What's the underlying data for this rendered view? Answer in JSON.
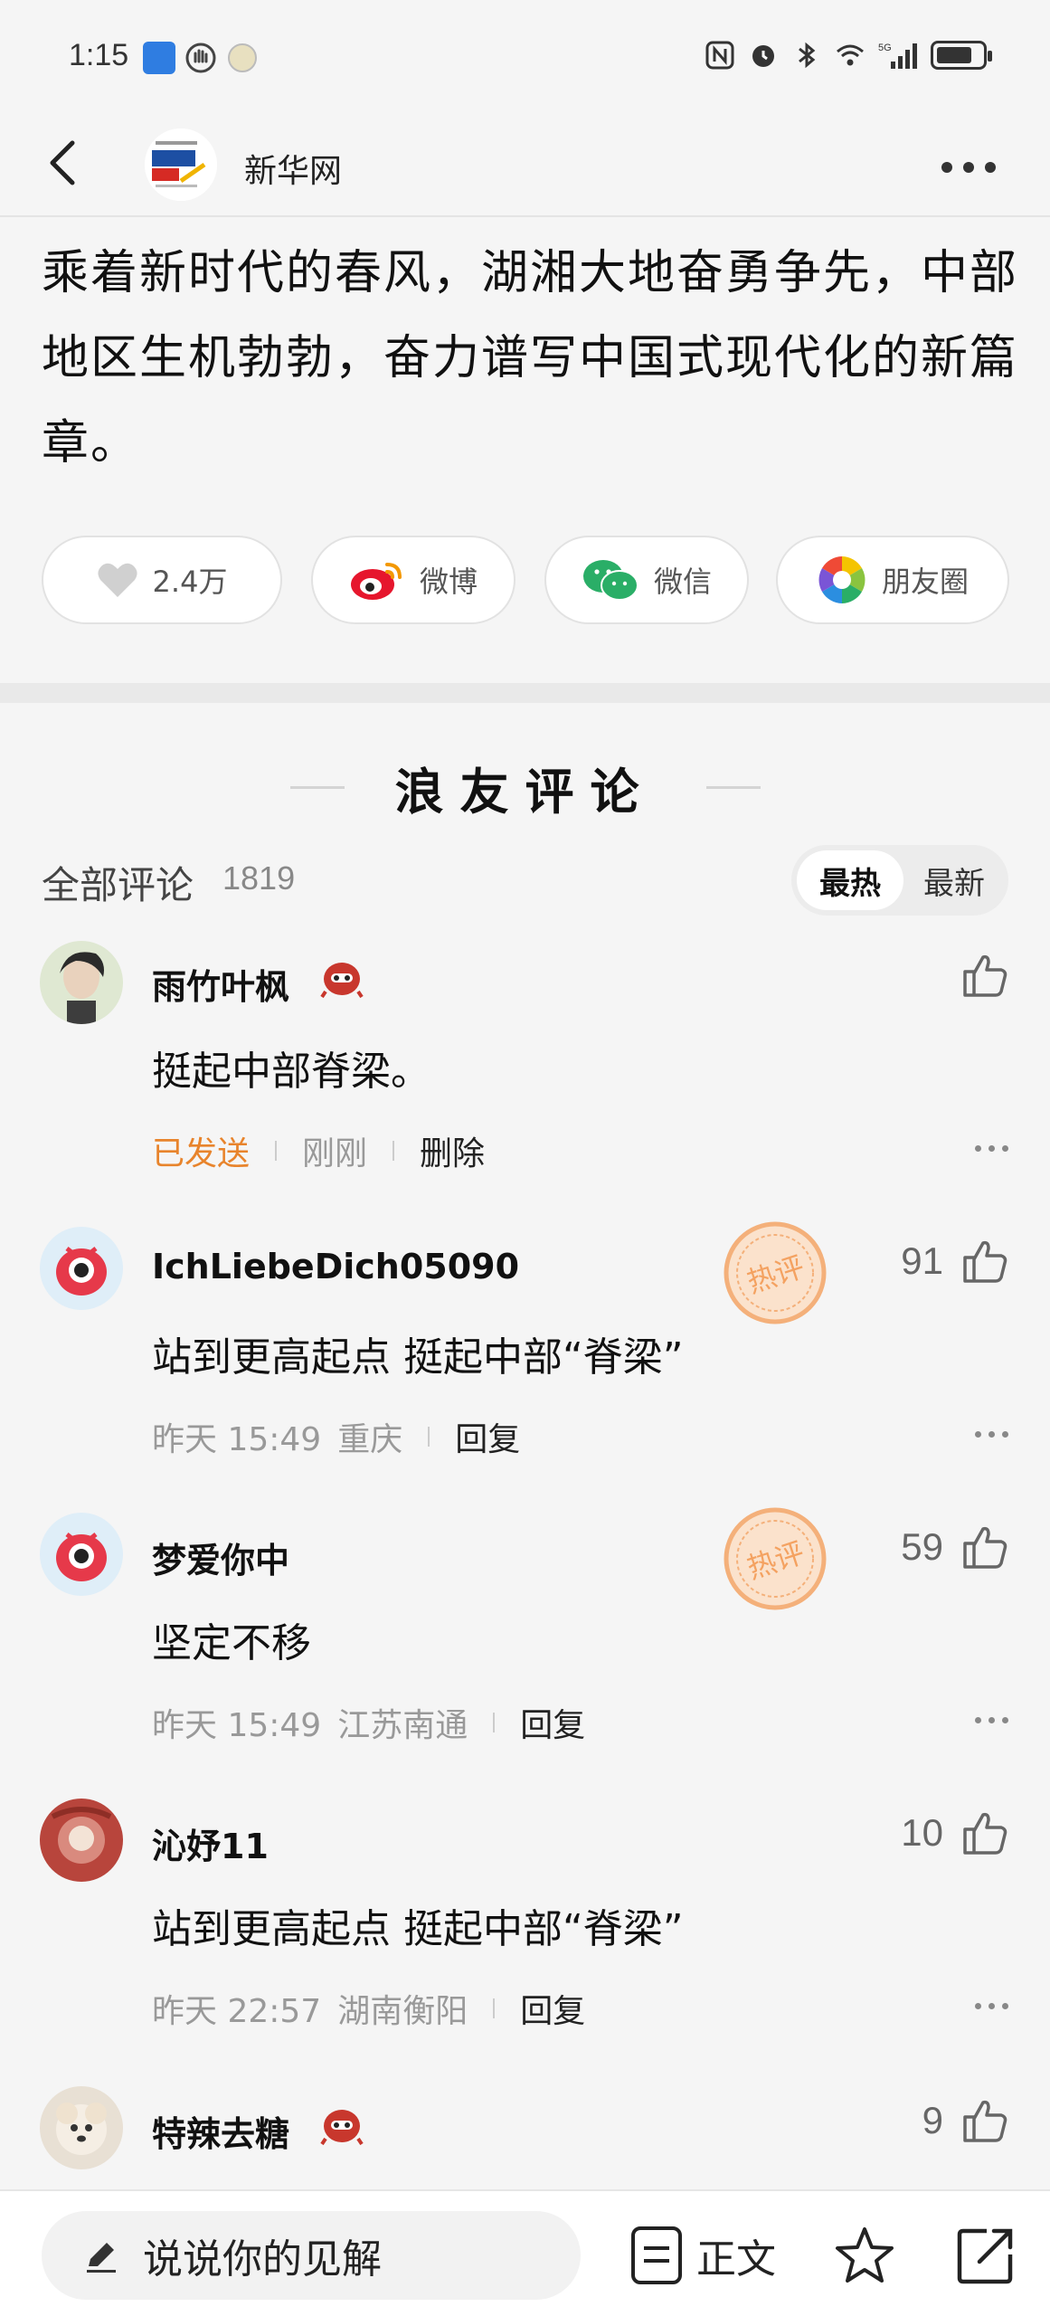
{
  "status_bar": {
    "time": "1:15",
    "network": "5G"
  },
  "header": {
    "site_name": "新华网"
  },
  "article": {
    "text": "乘着新时代的春风，湖湘大地奋勇争先，中部地区生机勃勃，奋力谱写中国式现代化的新篇章。"
  },
  "share": {
    "likes": "2.4万",
    "weibo": "微博",
    "wechat": "微信",
    "moments": "朋友圈"
  },
  "comments_section": {
    "title": "浪友评论",
    "all_label": "全部评论",
    "count": "1819",
    "sort_hot": "最热",
    "sort_new": "最新"
  },
  "comments": [
    {
      "name": "雨竹叶枫",
      "text": "挺起中部脊梁。",
      "status": "已发送",
      "time": "刚刚",
      "action": "删除",
      "likes": ""
    },
    {
      "name": "IchLiebeDich05090",
      "text": "站到更高起点 挺起中部“脊梁”",
      "time": "昨天 15:49",
      "location": "重庆",
      "action": "回复",
      "likes": "91",
      "hot_label": "热评"
    },
    {
      "name": "梦爱你中",
      "text": "坚定不移",
      "time": "昨天 15:49",
      "location": "江苏南通",
      "action": "回复",
      "likes": "59",
      "hot_label": "热评"
    },
    {
      "name": "沁妤11",
      "text": "站到更高起点 挺起中部“脊梁”",
      "time": "昨天 22:57",
      "location": "湖南衡阳",
      "action": "回复",
      "likes": "10"
    },
    {
      "name": "特辣去糖",
      "likes": "9"
    }
  ],
  "bottom_bar": {
    "input_placeholder": "说说你的见解",
    "main_text": "正文"
  },
  "colors": {
    "accent_orange": "#e8842c",
    "weibo_red": "#e6162d",
    "wechat_green": "#2aae67"
  }
}
